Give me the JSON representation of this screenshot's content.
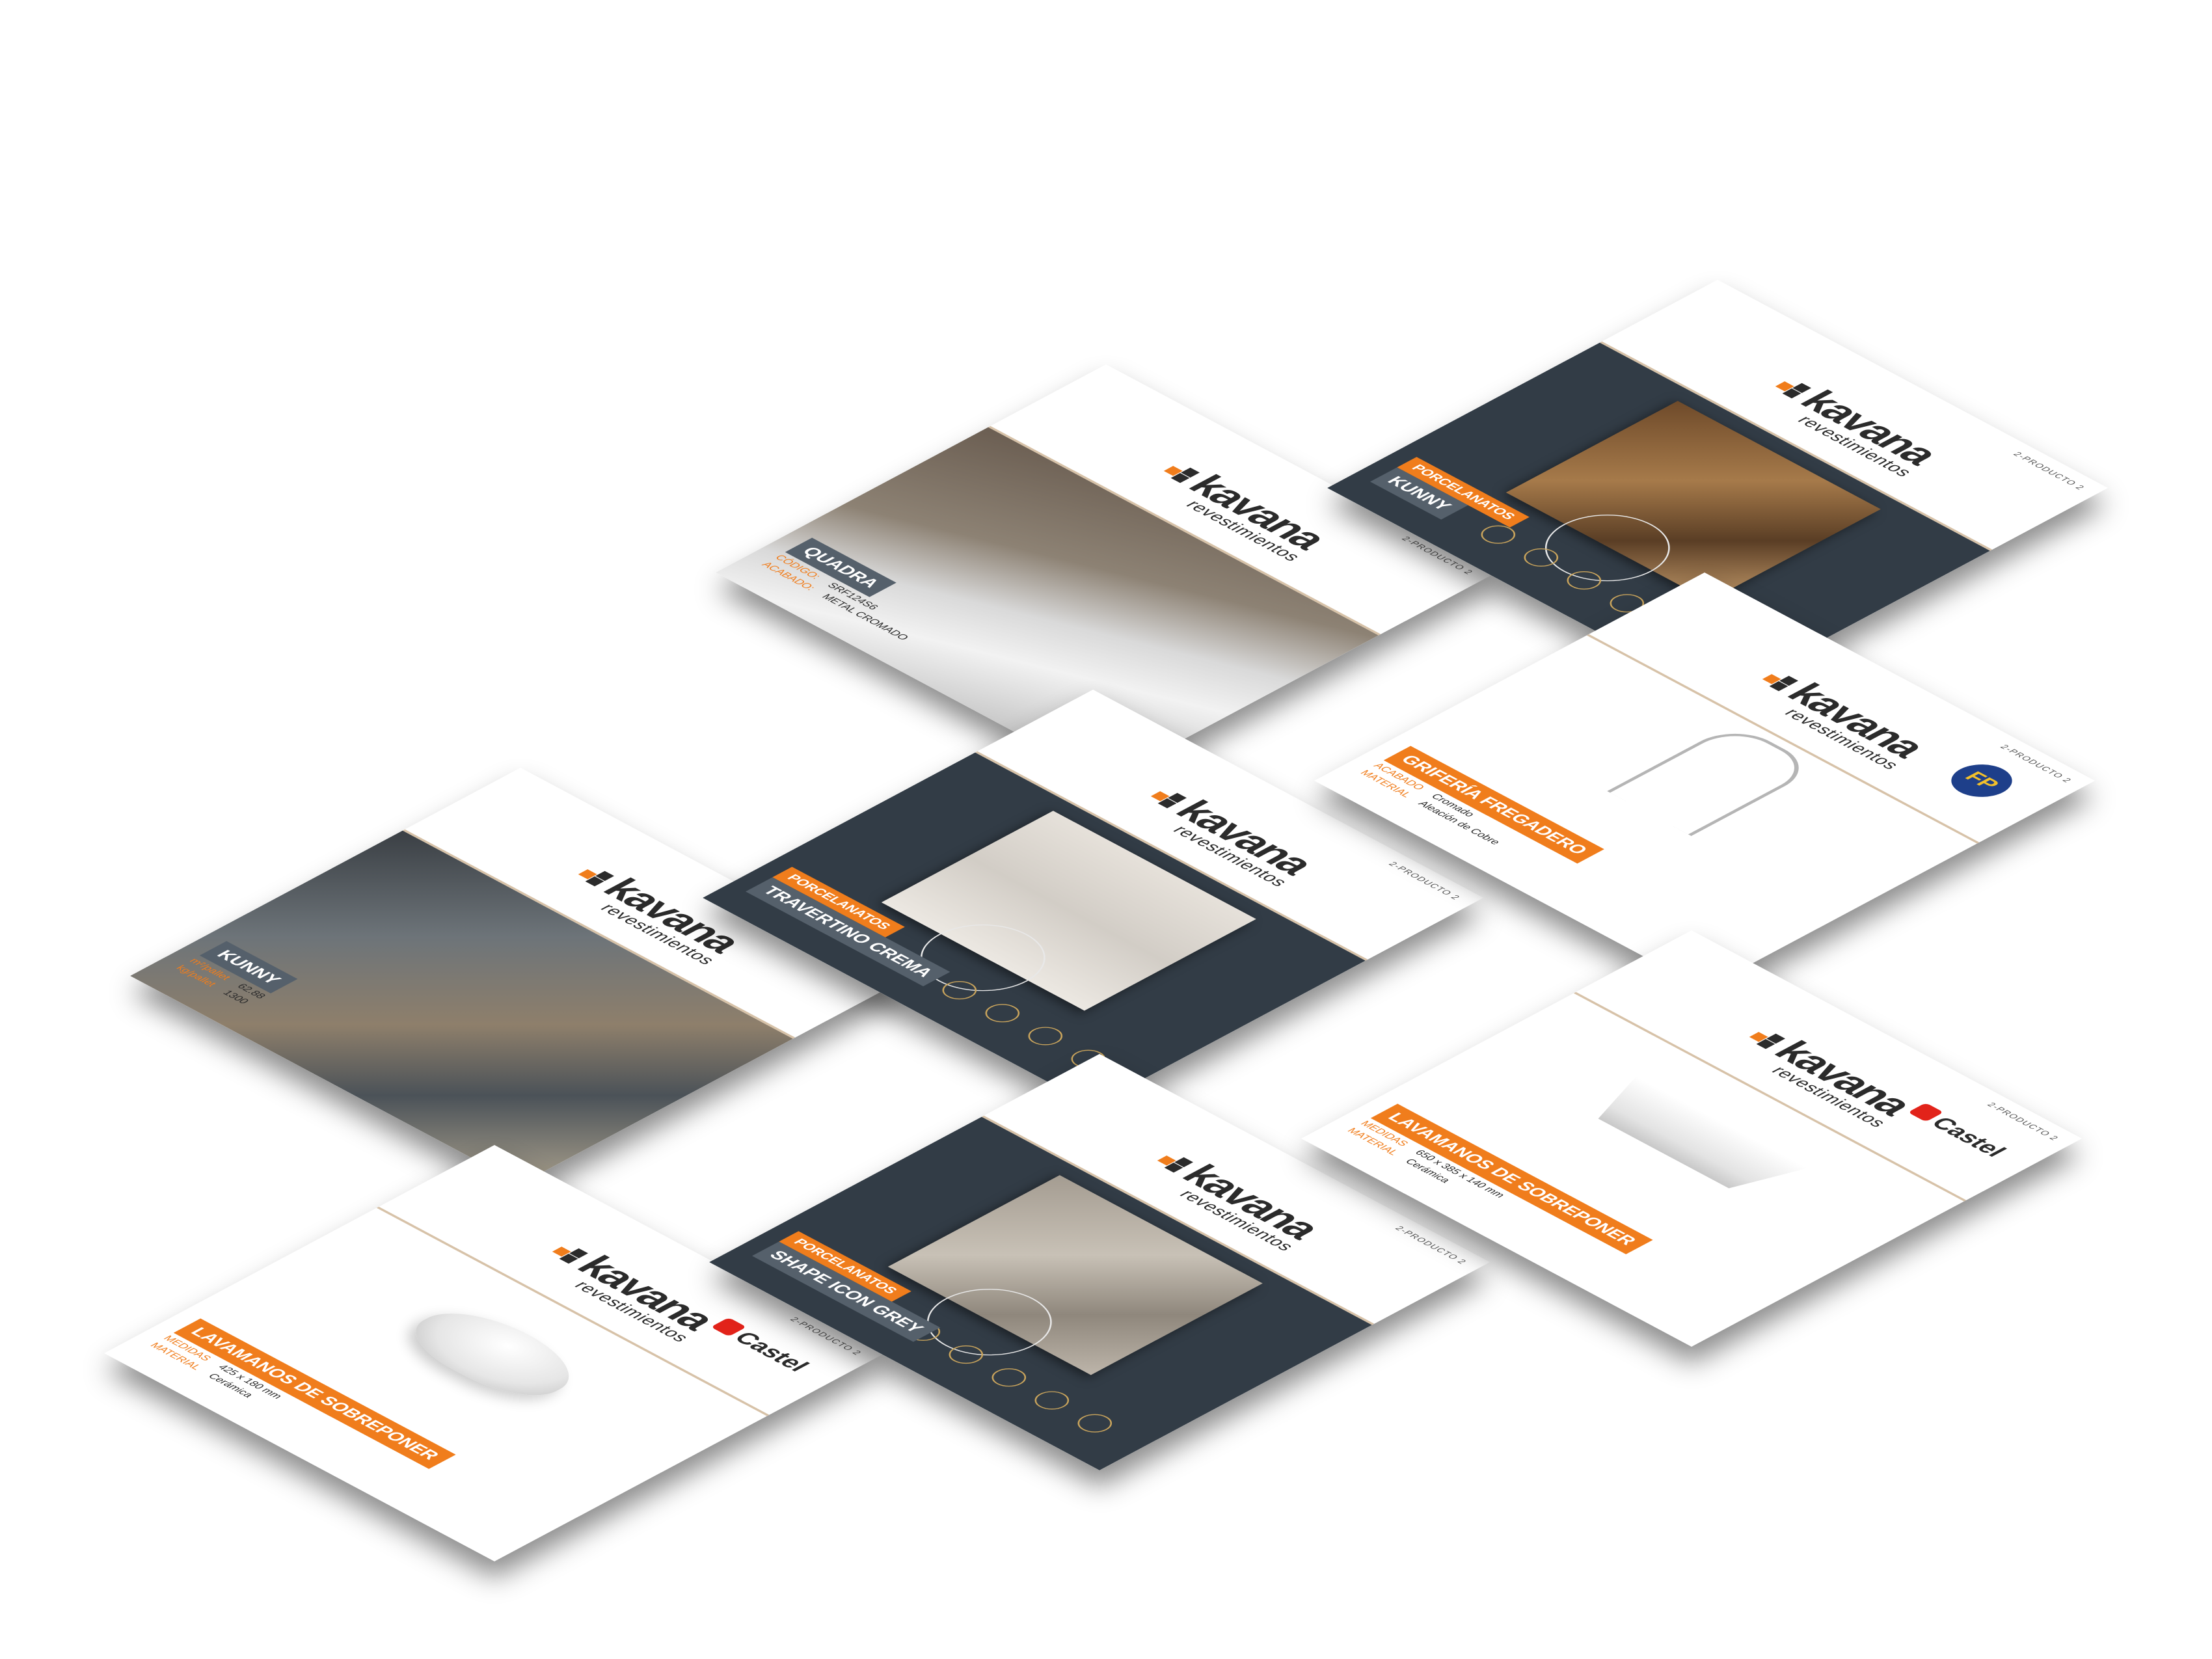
{
  "brand": {
    "logo_word": "kavana",
    "logo_sub": "revestimientos",
    "page_number": "2-PRODUCTO 2"
  },
  "cards": [
    {
      "id": "quadra",
      "theme": "photo-sink",
      "tag": "",
      "name": "QUADRA",
      "spec_rows": [
        {
          "label": "CÓDIGO:",
          "value": "SRF124S6"
        },
        {
          "label": "ACABADO:",
          "value": "METAL CROMADO"
        }
      ]
    },
    {
      "id": "kunny-rust",
      "theme": "dark-tile-rust",
      "tag": "PORCELANATOS",
      "name": "KUNNY",
      "spec_rows": []
    },
    {
      "id": "kunny-stone",
      "theme": "photo-stone",
      "tag": "",
      "name": "KUNNY",
      "spec_rows": [
        {
          "label": "m²/pallet",
          "value": "62.88"
        },
        {
          "label": "kg/pallet",
          "value": "1300"
        }
      ]
    },
    {
      "id": "travertino",
      "theme": "dark-tile-cream",
      "tag": "PORCELANATOS",
      "name": "TRAVERTINO CREMA",
      "spec_rows": []
    },
    {
      "id": "grifo",
      "theme": "white-faucet",
      "badge": "FP",
      "tag": "",
      "name": "GRIFERÍA FREGADERO",
      "spec_rows": [
        {
          "label": "ACABADO",
          "value": "Cromado"
        },
        {
          "label": "MATERIAL",
          "value": "Aleación de Cobre"
        }
      ]
    },
    {
      "id": "lavamanos-1",
      "theme": "white-basin",
      "badge": "Castel",
      "tag": "",
      "name": "LAVAMANOS DE SOBREPONER",
      "spec_rows": [
        {
          "label": "MEDIDAS",
          "value": "425 x 180 mm"
        },
        {
          "label": "MATERIAL",
          "value": "Cerámica"
        }
      ]
    },
    {
      "id": "shape-icon",
      "theme": "dark-tile-grey",
      "tag": "PORCELANATOS",
      "name": "SHAPE ICON GREY",
      "spec_rows": []
    },
    {
      "id": "lavamanos-2",
      "theme": "white-trough",
      "badge": "Castel",
      "tag": "",
      "name": "LAVAMANOS DE SOBREPONER",
      "spec_rows": [
        {
          "label": "MEDIDAS",
          "value": "650 x 385 x 140 mm"
        },
        {
          "label": "MATERIAL",
          "value": "Cerámica"
        }
      ]
    }
  ]
}
